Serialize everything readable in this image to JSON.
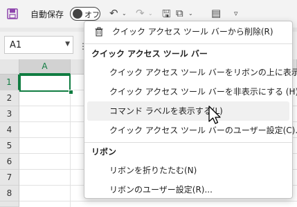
{
  "qat": {
    "autosave_label": "自動保存",
    "toggle_text": "オフ",
    "icons": [
      "save-icon",
      "undo-icon",
      "redo-icon",
      "save-as-icon",
      "copy-icon",
      "form-icon",
      "customize-qat-icon"
    ]
  },
  "name_box": {
    "value": "A1"
  },
  "grid": {
    "columns": [
      "A"
    ],
    "rows": [
      "1",
      "2",
      "3",
      "4",
      "5",
      "6",
      "7",
      "8",
      "9"
    ],
    "selected_column": "A",
    "selected_row": "1",
    "partial_column": "F"
  },
  "context_menu": {
    "remove_item": "クイック アクセス ツール バーから削除(R)",
    "qat_section": "クイック アクセス ツール バー",
    "qat_items": [
      "クイック アクセス ツール バーをリボンの上に表示(S)",
      "クイック アクセス ツール バーを非表示にする (H)",
      "コマンド ラベルを表示する(L)",
      "クイック アクセス ツール バーのユーザー設定(C)..."
    ],
    "ribbon_section": "リボン",
    "ribbon_items": [
      "リボンを折りたたむ(N)",
      "リボンのユーザー設定(R)..."
    ],
    "hovered_item": "コマンド ラベルを表示する(L)"
  },
  "colors": {
    "accent_green": "#107c41",
    "save_purple": "#8e44ad"
  }
}
